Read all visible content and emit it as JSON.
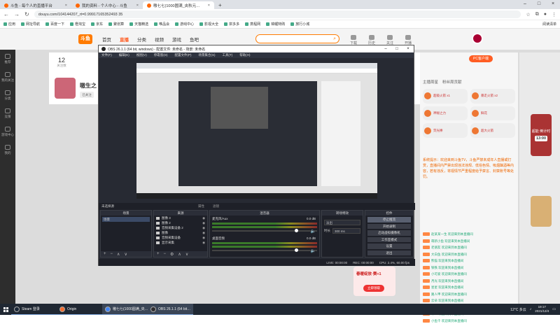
{
  "browser": {
    "tabs": [
      {
        "title": "斗鱼 - 每个人的直播平台",
        "active": false
      },
      {
        "title": "我的资料 - 个人中心 - 斗鱼",
        "active": false
      },
      {
        "title": "嗷七七(1000圆满_央秋元…",
        "active": true
      }
    ],
    "url": "douyu.com/104144207_rt=0.99917165352493 35",
    "bookmarks": [
      "应用",
      "网址导航",
      "百度一下",
      "橙淘宝",
      "京东",
      "聚划算",
      "天猫精选",
      "唯品会",
      "游戏中心",
      "影视大全",
      "拼多多",
      "携程网",
      "锦鲤特购",
      "旅行小城 "
    ],
    "reading_list": "阅读清单"
  },
  "douyu": {
    "logo": "斗鱼",
    "nav": [
      "首页",
      "直播",
      "分类",
      "视频",
      "游戏",
      "鱼吧"
    ],
    "nav_hot_index": 1,
    "search_icon": "search-icon",
    "top_icons": [
      "下载",
      "历史",
      "关注",
      "开播"
    ],
    "sidebar": [
      "推荐",
      "我的关注",
      "分类",
      "竞猜",
      "游戏中心",
      "我的"
    ],
    "fans_count": "12",
    "fans_label": "关注数",
    "streamer_name": "嗷生之",
    "follow_label": "已关注",
    "chat": {
      "pc_btn": "PC客户端",
      "tabs": [
        "主播周星",
        "粉丝周贡献"
      ],
      "gifts": [
        "超级火箭 x1",
        "暴走火箭 x2",
        "神秘之力",
        "鲜花",
        "荧光棒",
        "超大火箭"
      ],
      "notice": "系统提示：欢迎来到斗鱼TV，斗鱼严禁未成年人直播或打赏，直播间内严禁出现违法违规、低俗色情、吸烟酗酒等内容，若有违反，将视情节严重程度给予禁言、封禁账号等处罚。",
      "messages": [
        "赵某某一生 欢迎来到本直播间",
        "萌新小鱼 欢迎来到本直播间",
        "老朋友 欢迎来到本直播间",
        "大白鱼 欢迎来到本直播间",
        "熊猫 欢迎来到本直播间",
        "铁铁 欢迎来到本直播间",
        "小可爱 欢迎来到本直播间",
        "月光 欢迎来到本直播间",
        "星星 欢迎来到本直播间",
        "路人甲 欢迎来到本直播间",
        "云朵 欢迎来到本直播间",
        "夏天 欢迎来到本直播间",
        "十一 欢迎来到本直播间",
        "小鱼干 欢迎来到本直播间"
      ]
    },
    "badge_label": "超能 倒计时",
    "badge_timer": "13:00",
    "promo_title": "春暖绽放·赛+1",
    "promo_btn": "立即领取"
  },
  "obs": {
    "title": "OBS 26.1.1 (64 bit, windows) - 配置文件: 未命名 - 场景: 未命名",
    "menu": [
      "文件(F)",
      "编辑(E)",
      "视图(V)",
      "停靠窗(D)",
      "配置文件(P)",
      "场景集合(S)",
      "工具(T)",
      "帮助(H)"
    ],
    "no_source": "未选择源",
    "props_btn": "属性",
    "filters_btn": "滤镜",
    "docks": {
      "scenes": "场景",
      "sources": "来源",
      "mixer": "混音器",
      "transitions": "转场特效",
      "controls": "控件"
    },
    "scene_items": [
      "场景"
    ],
    "source_items": [
      "图像 3",
      "图像 2",
      "音频采集设备 2",
      "图像",
      "音频采集设备",
      "显示采集"
    ],
    "mixer_channels": [
      {
        "name": "麦克风/Aux",
        "db": "0.0 dB"
      },
      {
        "name": "桌面音频",
        "db": "0.0 dB"
      }
    ],
    "transition": "淡出",
    "duration_label": "时长",
    "duration": "300 ms",
    "control_buttons": [
      "停止推流",
      "开始录制",
      "启动虚拟摄像机",
      "工作室模式",
      "设置",
      "退出"
    ],
    "status": {
      "live": "LIVE: 00:00:00",
      "rec": "REC: 00:00:00",
      "cpu": "CPU: 2.4%, 60.00 fps"
    }
  },
  "taskbar": {
    "apps": [
      "Steam 登录",
      "Origin",
      "嗷七七(1000圆满_央…",
      "OBS 26.1.1 (64 bit…"
    ],
    "weather": "12°C 多云",
    "time": "19:17",
    "date": "2021/12/4"
  }
}
